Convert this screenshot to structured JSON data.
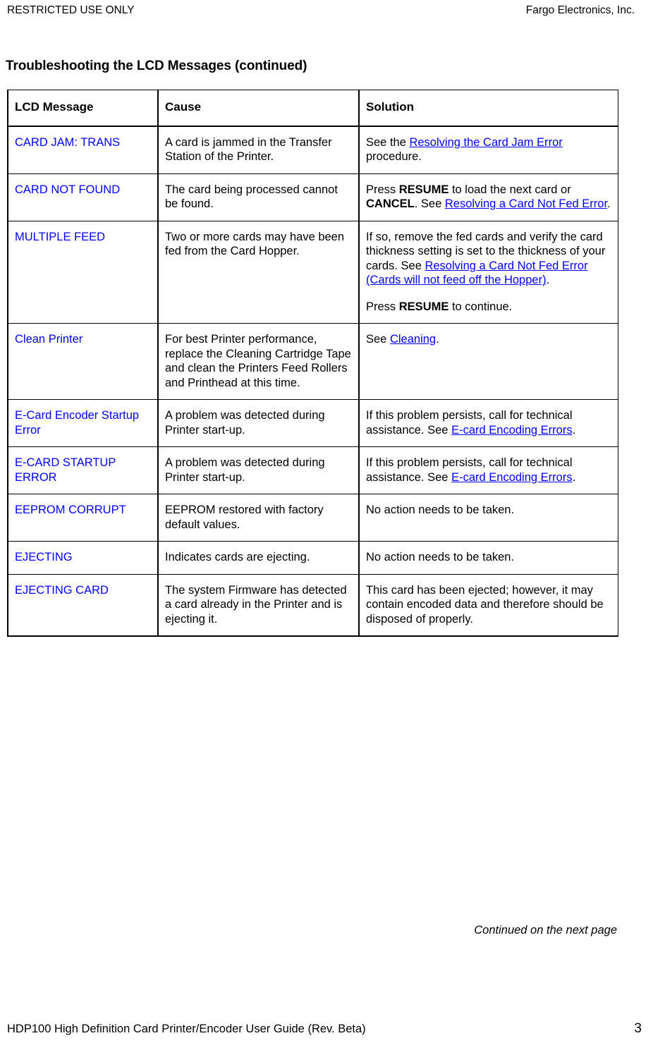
{
  "header": {
    "left": "RESTRICTED USE ONLY",
    "right": "Fargo Electronics, Inc."
  },
  "title": "Troubleshooting the LCD Messages (continued)",
  "table": {
    "columns": [
      "LCD Message",
      "Cause",
      "Solution"
    ],
    "rows": [
      {
        "message": "CARD JAM: TRANS",
        "cause": "A card is jammed in the Transfer Station of the Printer.",
        "solution_parts": [
          [
            {
              "t": "text",
              "v": "See the "
            },
            {
              "t": "link",
              "v": "Resolving the Card Jam Error"
            },
            {
              "t": "text",
              "v": " procedure."
            }
          ]
        ]
      },
      {
        "message": "CARD NOT FOUND",
        "cause": "The card being processed cannot be found.",
        "solution_parts": [
          [
            {
              "t": "text",
              "v": "Press "
            },
            {
              "t": "bold",
              "v": "RESUME"
            },
            {
              "t": "text",
              "v": " to load the next card or "
            },
            {
              "t": "bold",
              "v": "CANCEL"
            },
            {
              "t": "text",
              "v": ". See "
            },
            {
              "t": "link",
              "v": "Resolving a Card Not Fed Error"
            },
            {
              "t": "text",
              "v": "."
            }
          ]
        ]
      },
      {
        "message": "MULTIPLE FEED",
        "cause": "Two or more cards may have been fed from the Card Hopper.",
        "solution_parts": [
          [
            {
              "t": "text",
              "v": "If so, remove the fed cards and verify the card thickness setting is set to the thickness of your cards. See "
            },
            {
              "t": "link",
              "v": "Resolving a Card Not Fed Error (Cards will not feed off the Hopper)"
            },
            {
              "t": "text",
              "v": "."
            }
          ],
          [
            {
              "t": "text",
              "v": "Press "
            },
            {
              "t": "bold",
              "v": "RESUME"
            },
            {
              "t": "text",
              "v": " to continue."
            }
          ]
        ]
      },
      {
        "message": "Clean Printer",
        "cause": "For best Printer performance, replace the Cleaning Cartridge Tape and clean the Printers Feed Rollers and Printhead at this time.",
        "solution_parts": [
          [
            {
              "t": "text",
              "v": "See "
            },
            {
              "t": "link",
              "v": "Cleaning"
            },
            {
              "t": "text",
              "v": "."
            }
          ]
        ]
      },
      {
        "message": "E-Card Encoder Startup Error",
        "cause": "A problem was detected during Printer start-up.",
        "solution_parts": [
          [
            {
              "t": "text",
              "v": "If this problem persists, call for technical assistance. See "
            },
            {
              "t": "link",
              "v": "E-card Encoding Errors"
            },
            {
              "t": "text",
              "v": "."
            }
          ]
        ]
      },
      {
        "message": "E-CARD STARTUP ERROR",
        "cause": "A problem was detected during Printer start-up.",
        "solution_parts": [
          [
            {
              "t": "text",
              "v": "If this problem persists, call for technical assistance. See "
            },
            {
              "t": "link",
              "v": "E-card Encoding Errors"
            },
            {
              "t": "text",
              "v": "."
            }
          ]
        ]
      },
      {
        "message": "EEPROM CORRUPT",
        "cause": "EEPROM restored with factory default values.",
        "solution_parts": [
          [
            {
              "t": "text",
              "v": "No action needs to be taken."
            }
          ]
        ]
      },
      {
        "message": "EJECTING",
        "cause": "Indicates cards are ejecting.",
        "solution_parts": [
          [
            {
              "t": "text",
              "v": "No action needs to be taken."
            }
          ]
        ]
      },
      {
        "message": "EJECTING CARD",
        "cause": "The system Firmware has detected a card already in the Printer and is ejecting it.",
        "solution_parts": [
          [
            {
              "t": "text",
              "v": "This card has been ejected; however, it may contain encoded data and therefore should be disposed of properly."
            }
          ]
        ]
      }
    ]
  },
  "continued_note": "Continued on the next page",
  "footer": {
    "title": "HDP100 High Definition Card Printer/Encoder User Guide (Rev. Beta)",
    "page_number": "3"
  },
  "colors": {
    "link": "#0000FF",
    "message": "#0000FF",
    "text": "#000000"
  }
}
